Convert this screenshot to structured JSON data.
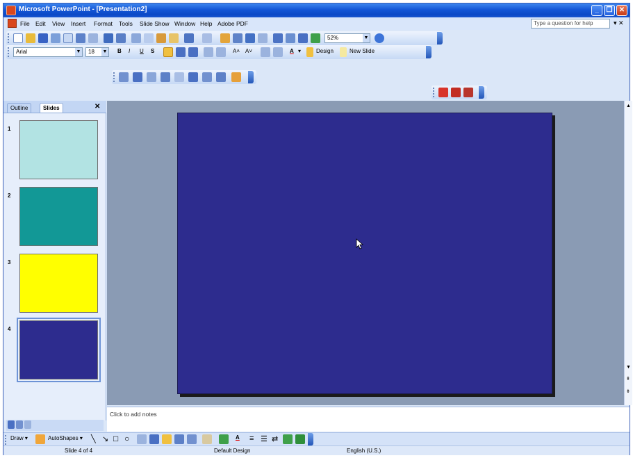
{
  "window": {
    "title": "Microsoft PowerPoint - [Presentation2]",
    "buttons": {
      "minimize": "_",
      "restore": "❐",
      "close": "✕"
    }
  },
  "menubar": {
    "items": [
      "File",
      "Edit",
      "View",
      "Insert",
      "Format",
      "Tools",
      "Slide Show",
      "Window",
      "Help",
      "Adobe PDF"
    ],
    "help_placeholder": "Type a question for help",
    "help_close": "▾ ✕"
  },
  "toolbar_standard": {
    "zoom": "52%"
  },
  "toolbar_formatting": {
    "font": "Arial",
    "size": "18",
    "design_label": "Design",
    "new_slide_label": "New Slide"
  },
  "panel": {
    "tabs": [
      "Outline",
      "Slides"
    ],
    "close": "✕",
    "slides": [
      {
        "number": "1",
        "color": "#b2e3e3"
      },
      {
        "number": "2",
        "color": "#129896"
      },
      {
        "number": "3",
        "color": "#ffff00"
      },
      {
        "number": "4",
        "color": "#2d2c8e",
        "selected": true
      }
    ]
  },
  "slide": {
    "background": "#2d2c8e"
  },
  "notes": {
    "placeholder": "Click to add notes"
  },
  "drawbar": {
    "draw_label": "Draw ▾",
    "autoshapes_label": "AutoShapes ▾"
  },
  "status": {
    "slide_info": "Slide 4 of 4",
    "design": "Default Design",
    "language": "English (U.S.)"
  },
  "colors": {
    "title_bar": "#0b49c7",
    "toolbar": "#c6d9f5",
    "stage": "#8a9bb4"
  }
}
